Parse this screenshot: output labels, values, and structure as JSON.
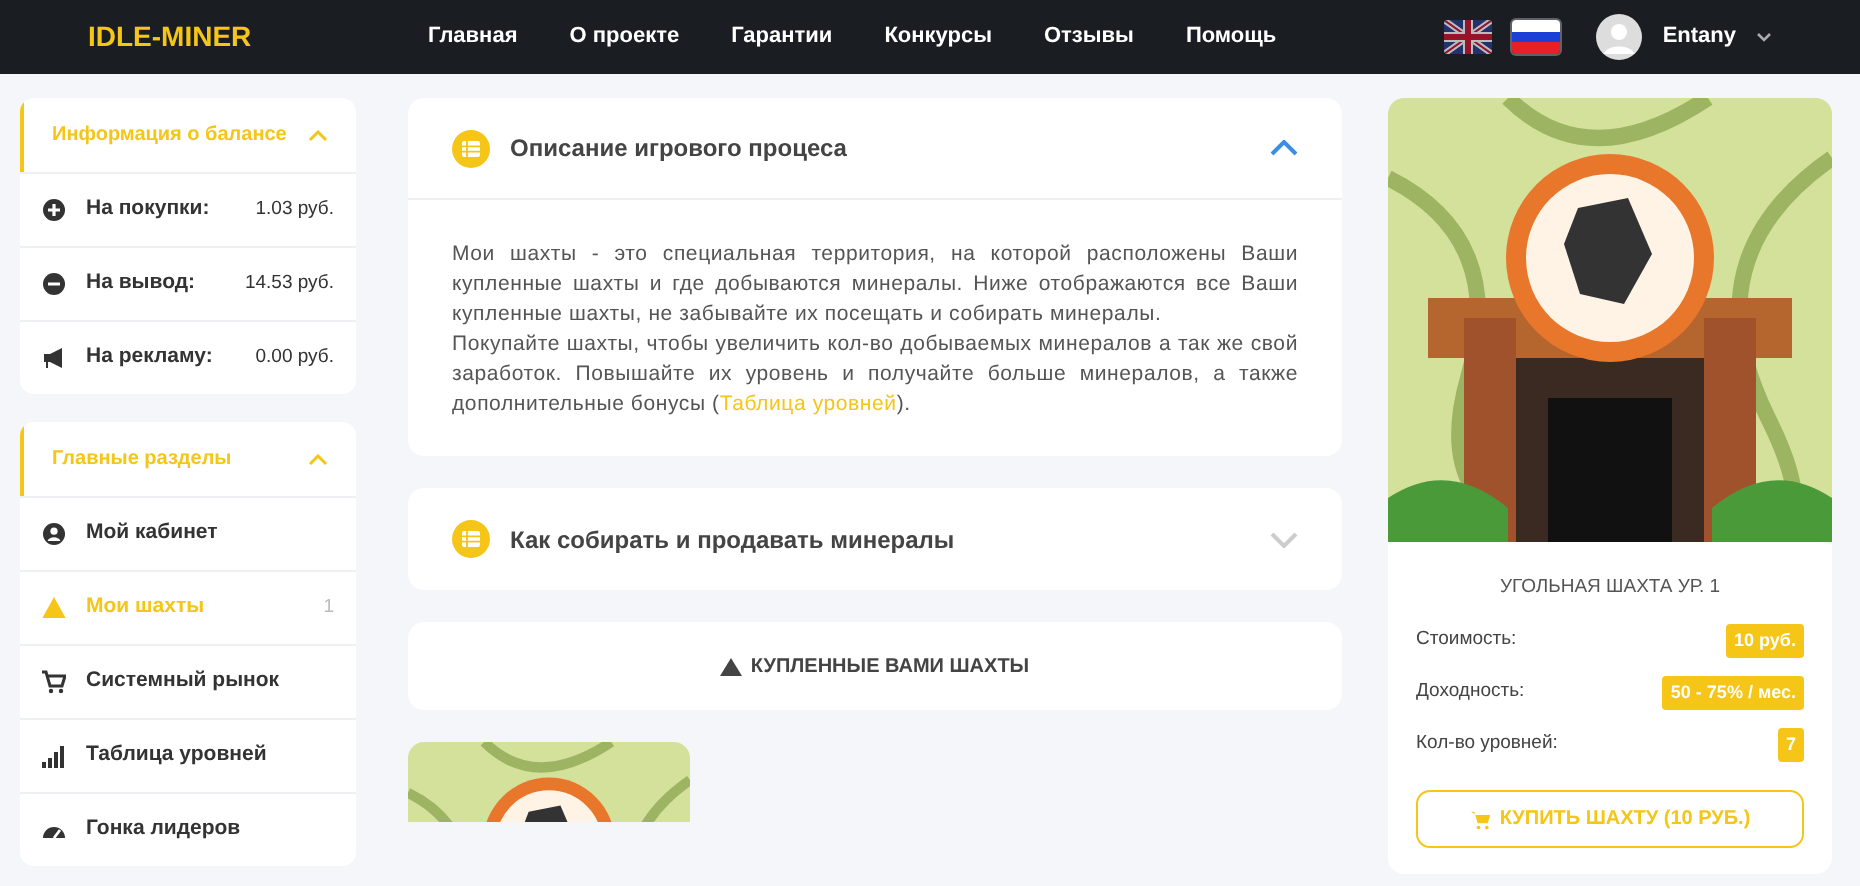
{
  "header": {
    "logo": "IDLE-MINER",
    "nav": [
      {
        "label": "Главная"
      },
      {
        "label": "О проекте"
      },
      {
        "label": "Гарантии"
      },
      {
        "label": "Конкурсы"
      },
      {
        "label": "Отзывы"
      },
      {
        "label": "Помощь"
      }
    ],
    "languages": [
      {
        "kind": "uk",
        "selected": false
      },
      {
        "kind": "ru",
        "selected": true
      }
    ],
    "user": {
      "name": "Entany"
    }
  },
  "sidebar": [
    {
      "title": "Информация о балансе",
      "expanded": true,
      "items": [
        {
          "kind": "plus",
          "label": "На покупки:",
          "value": "1.03 руб.",
          "selected": false
        },
        {
          "kind": "minus",
          "label": "На вывод:",
          "value": "14.53 руб.",
          "selected": false
        },
        {
          "kind": "megaphone",
          "label": "На рекламу:",
          "value": "0.00 руб.",
          "selected": false
        }
      ]
    },
    {
      "title": "Главные разделы",
      "expanded": true,
      "items": [
        {
          "kind": "user",
          "label": "Мой кабинет",
          "selected": false
        },
        {
          "kind": "warning",
          "label": "Мои шахты",
          "value": "1",
          "selected": true
        },
        {
          "kind": "cart",
          "label": "Системный рынок",
          "selected": false
        },
        {
          "kind": "bars",
          "label": "Таблица уровней",
          "selected": false
        },
        {
          "kind": "gauge",
          "label": "Гонка лидеров",
          "selected": false
        }
      ]
    }
  ],
  "accordion": [
    {
      "title": "Описание игрового процеса",
      "expanded": true,
      "paragraphs": [
        "Мои шахты - это специальная территория, на которой расположены Ваши купленные шахты и где добываются минералы. Ниже отображаются все Ваши купленные шахты, не забывайте их посещать и собирать минералы.",
        "Покупайте шахты, чтобы увеличить кол-во добываемых минералов а так же свой заработок. Повышайте их уровень и получайте больше минералов, а также дополнительные бонусы ("
      ],
      "link": "Таблица уровней",
      "after_link": ")."
    },
    {
      "title": "Как собирать и продавать минералы",
      "expanded": false
    }
  ],
  "purchased_heading": "КУПЛЕННЫЕ ВАМИ ШАХТЫ",
  "shop_card": {
    "title": "УГОЛЬНАЯ ШАХТА УР. 1",
    "stats": [
      {
        "label": "Стоимость:",
        "value": "10 руб."
      },
      {
        "label": "Доходность:",
        "value": "50 - 75% / мес."
      },
      {
        "label": "Кол-во уровней:",
        "value": "7"
      }
    ],
    "button": "КУПИТЬ ШАХТУ (10 РУБ.)"
  }
}
